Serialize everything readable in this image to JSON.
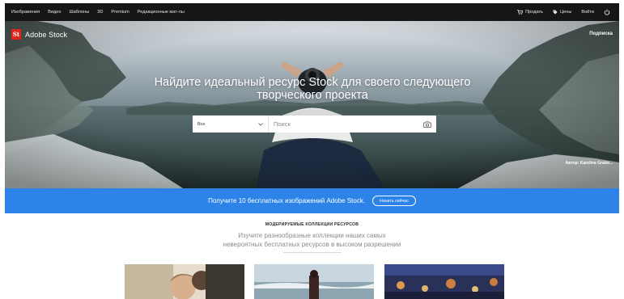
{
  "nav": {
    "left": [
      "Изображения",
      "Видео",
      "Шаблоны",
      "3D",
      "Premium",
      "Редакционные мат-лы"
    ],
    "right": {
      "sell": "Продать",
      "pricing": "Цены",
      "login": "Войти"
    }
  },
  "hero": {
    "logo_badge": "St",
    "logo_text": "Adobe Stock",
    "signin": "Подписка",
    "headline_line1": "Найдите идеальный ресурс Stock для своего следующего",
    "headline_line2": "творческого проекта",
    "search": {
      "category": "Все",
      "placeholder": "Поиск"
    },
    "credit": "Автор: Karolina Grabo..."
  },
  "banner": {
    "text": "Получите 10 бесплатных изображений Adobe Stock.",
    "button": "Начать сейчас"
  },
  "collections": {
    "heading": "МОДЕРИРУЕМЫЕ КОЛЛЕКЦИИ РЕСУРСОВ",
    "subtitle_line1": "Изучите разнообразные коллекции наших самых",
    "subtitle_line2": "невероятных бесплатных ресурсов в высоком разрешении"
  },
  "icons": {
    "sell": "cart-icon",
    "pricing": "tag-icon",
    "account": "power-icon",
    "camera": "camera-icon",
    "dropdown": "chevron-down-icon"
  },
  "colors": {
    "nav_bg": "#161616",
    "banner_bg": "#2d83e8",
    "logo_red": "#e0251b"
  }
}
